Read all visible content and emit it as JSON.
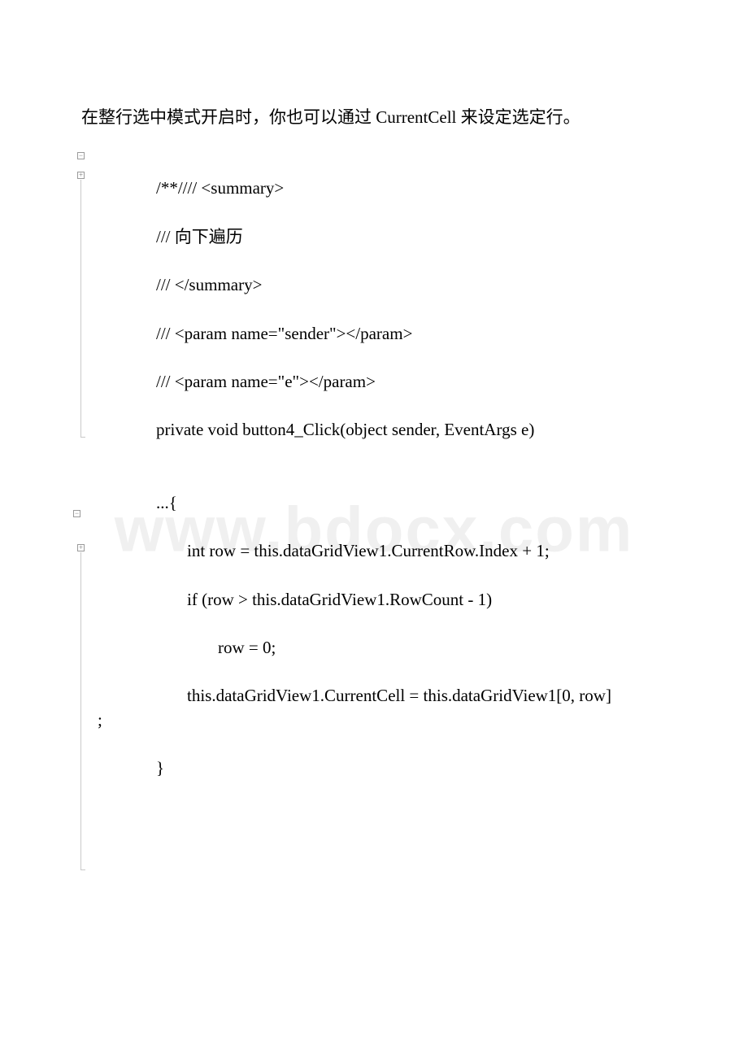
{
  "watermark": "www.bdocx.com",
  "intro": "在整行选中模式开启时，你也可以通过 CurrentCell 来设定选定行。",
  "code": {
    "l1": "/**//// <summary>",
    "l2": "/// 向下遍历",
    "l3": "/// </summary>",
    "l4": "/// <param name=\"sender\"></param>",
    "l5": "/// <param name=\"e\"></param>",
    "l6": "private void button4_Click(object sender, EventArgs e)",
    "l7": "...{",
    "l8": "int row = this.dataGridView1.CurrentRow.Index + 1;",
    "l9": "if (row > this.dataGridView1.RowCount - 1)",
    "l10": "row = 0;",
    "l11a": "this.dataGridView1.CurrentCell = this.dataGridView1[0, row]",
    "l11b": ";",
    "l12": "}"
  }
}
